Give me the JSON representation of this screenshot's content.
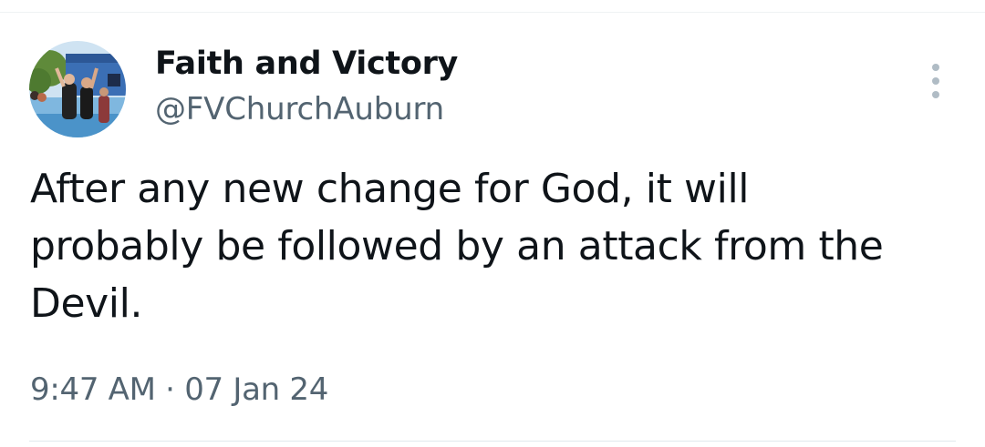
{
  "tweet": {
    "author": {
      "display_name": "Faith and Victory",
      "handle": "@FVChurchAuburn",
      "avatar_icon": "profile-photo-avatar"
    },
    "more_icon": "more-vertical-icon",
    "text": "After any new change for God, it will\nprobably be followed by an attack from the\nDevil.",
    "time": "9:47 AM",
    "separator": "·",
    "date": "07 Jan 24"
  },
  "colors": {
    "text_primary": "#0f1419",
    "text_secondary": "#536471",
    "divider": "#e1e8ed",
    "background": "#ffffff"
  }
}
